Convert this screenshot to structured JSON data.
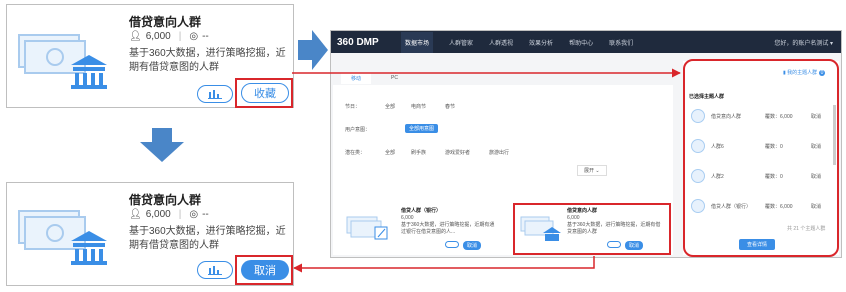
{
  "card": {
    "title": "借贷意向人群",
    "count": "6,000",
    "separator": "|",
    "views": "--",
    "desc": "基于360大数据，进行策略挖掘，近期有借贷意图的人群",
    "fav_label": "收藏",
    "cancel_label": "取消"
  },
  "screen": {
    "logo": "360 DMP",
    "nav": [
      "数据市场",
      "人群管家",
      "人群透视",
      "效果分析",
      "帮助中心",
      "联系我们"
    ],
    "user": "您好，的账户名测试 ▾",
    "tabs": [
      "移动",
      "PC"
    ],
    "filters": [
      {
        "label": "节日：",
        "options": [
          "全部",
          "电商节",
          "春节"
        ]
      },
      {
        "label": "用户意图：",
        "options": [
          "全部用意图"
        ]
      },
      {
        "label": "潜在类：",
        "options": [
          "全部",
          "刷手族",
          "游戏爱好者",
          "旅游出行"
        ]
      }
    ],
    "expand": "展开 ⌄",
    "right_panel": {
      "header": "我的主题人群",
      "badge": "0",
      "title": "已选择主题人群",
      "rows": [
        {
          "name": "借贷意向人群",
          "count": "覆数：6,000",
          "action": "取消"
        },
        {
          "name": "人群6",
          "count": "覆数：0",
          "action": "取消"
        },
        {
          "name": "人群2",
          "count": "覆数：0",
          "action": "取消"
        },
        {
          "name": "借贷人群（银行）",
          "count": "覆数：6,000",
          "action": "取消"
        }
      ],
      "footer": "共 21 个主题人群",
      "button": "查看详情"
    },
    "cards": [
      {
        "title": "借贷人群（银行）",
        "count": "6,000",
        "desc": "基于360大数据，进行策略挖掘，近期有通过银行在借贷意图的人...",
        "btn": "取消"
      },
      {
        "title": "借贷意向人群",
        "count": "6,000",
        "desc": "基于360大数据，进行策略挖掘，近期有借贷意图的人群",
        "btn": "取消"
      }
    ]
  },
  "colors": {
    "accent": "#3a8ee6",
    "highlight": "#d9262b",
    "arrow": "#4a86c8"
  }
}
